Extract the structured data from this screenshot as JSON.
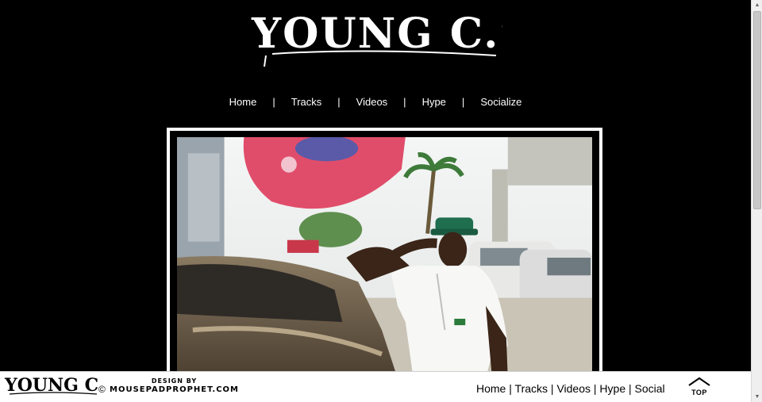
{
  "brand": {
    "logo_text": "YOUNG C.S."
  },
  "nav": {
    "items": [
      "Home",
      "Tracks",
      "Videos",
      "Hype",
      "Socialize"
    ],
    "separator": "|"
  },
  "footer": {
    "logo_text": "YOUNG C.S.",
    "copyright": "©",
    "credit_line1": "DESIGN BY",
    "credit_line2": "MOUSEPADPROPHET.COM",
    "nav": [
      "Home",
      "Tracks",
      "Videos",
      "Hype",
      "Social"
    ],
    "separator": " | ",
    "top_label": "TOP"
  },
  "colors": {
    "background": "#000000",
    "footer_bg": "#ffffff",
    "text": "#ffffff"
  },
  "icons": {
    "top": "house-arrow-icon"
  }
}
